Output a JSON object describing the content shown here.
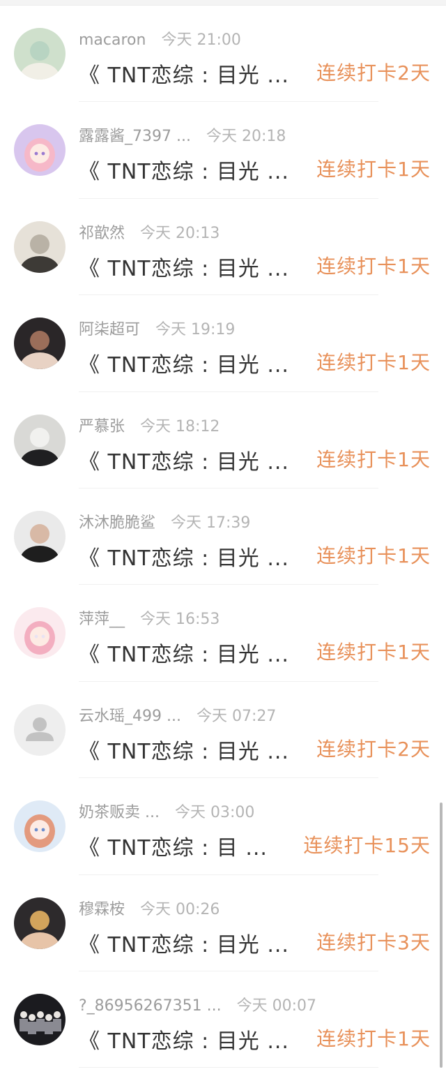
{
  "items": [
    {
      "user": "macaron",
      "time": "今天 21:00",
      "title": "《 TNT恋综 : 目光 ...",
      "streak": "连续打卡2天",
      "avatar": "photo-avatar",
      "colors": [
        "#cfe0cc",
        "#f1efe6",
        "#b8d4c2"
      ]
    },
    {
      "user": "露露酱_7397 ...",
      "time": "今天 20:18",
      "title": "《 TNT恋综 : 目光 ...",
      "streak": "连续打卡1天",
      "avatar": "anime-girl-avatar",
      "colors": [
        "#d8c6ee",
        "#f6b8c8",
        "#9a7ad0"
      ]
    },
    {
      "user": "祁歆然",
      "time": "今天 20:13",
      "title": "《 TNT恋综 : 目光 ...",
      "streak": "连续打卡1天",
      "avatar": "photo-avatar",
      "colors": [
        "#e6e1d8",
        "#3d3a36",
        "#b9b2a6"
      ]
    },
    {
      "user": "阿柒超可",
      "time": "今天 19:19",
      "title": "《 TNT恋综 : 目光 ...",
      "streak": "连续打卡1天",
      "avatar": "photo-avatar",
      "colors": [
        "#2a2628",
        "#e8d2c4",
        "#9b6e5a"
      ]
    },
    {
      "user": "严慕张",
      "time": "今天 18:12",
      "title": "《 TNT恋综 : 目光 ...",
      "streak": "连续打卡1天",
      "avatar": "photo-avatar",
      "colors": [
        "#d9d9d6",
        "#1f1f21",
        "#f1f1ef"
      ]
    },
    {
      "user": "沐沐脆脆鲨",
      "time": "今天 17:39",
      "title": "《 TNT恋综 : 目光 ...",
      "streak": "连续打卡1天",
      "avatar": "photo-avatar",
      "colors": [
        "#eaeaea",
        "#1e1e1e",
        "#d8b9a6"
      ]
    },
    {
      "user": "萍萍__",
      "time": "今天 16:53",
      "title": "《 TNT恋综 : 目光 ...",
      "streak": "连续打卡1天",
      "avatar": "anime-girl-avatar",
      "colors": [
        "#fbeaee",
        "#f3aec0",
        "#e9e3f2"
      ]
    },
    {
      "user": "云水瑶_499 ...",
      "time": "今天 07:27",
      "title": "《 TNT恋综 : 目光 ...",
      "streak": "连续打卡2天",
      "avatar": "default-user-avatar",
      "colors": [
        "#eeeeee",
        "#c2c2c2",
        "#c2c2c2"
      ]
    },
    {
      "user": "奶茶贩卖 ...",
      "time": "今天 03:00",
      "title": "《 TNT恋综 : 目 ...",
      "streak": "连续打卡15天",
      "avatar": "anime-girl-avatar",
      "colors": [
        "#dfeaf6",
        "#e39a7e",
        "#6e8fce"
      ]
    },
    {
      "user": "穆霖桉",
      "time": "今天 00:26",
      "title": "《 TNT恋综 : 目光 ...",
      "streak": "连续打卡3天",
      "avatar": "photo-avatar",
      "colors": [
        "#2d2a2c",
        "#e7c4a8",
        "#d2a45c"
      ]
    },
    {
      "user": "?_86956267351 ...",
      "time": "今天 00:07",
      "title": "《 TNT恋综 : 目光 ...",
      "streak": "连续打卡1天",
      "avatar": "group-photo-avatar",
      "colors": [
        "#1b1b1f",
        "#eae6e2",
        "#8a8a92"
      ]
    }
  ],
  "theme": {
    "streak_color": "#e8915a",
    "username_color": "#9c9c9c",
    "title_color": "#333333"
  }
}
